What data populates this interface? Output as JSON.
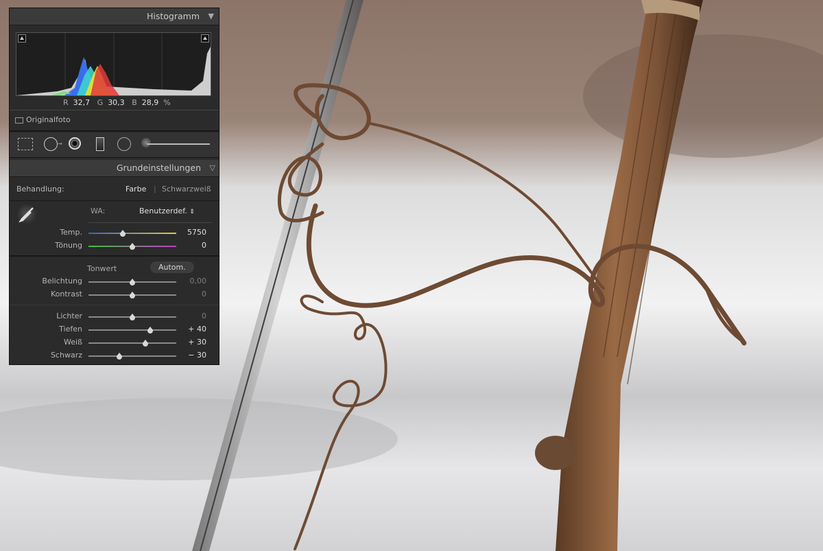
{
  "histogram": {
    "title": "Histogramm",
    "readout": {
      "r_label": "R",
      "r_value": "32,7",
      "g_label": "G",
      "g_value": "30,3",
      "b_label": "B",
      "b_value": "28,9",
      "unit": "%"
    },
    "original_photo_label": "Originalfoto"
  },
  "tools": {
    "icons": [
      "crop-overlay-icon",
      "spot-removal-icon",
      "red-eye-icon",
      "graduated-filter-icon",
      "radial-filter-icon",
      "adjustment-brush-icon"
    ],
    "amount_level": 0.03
  },
  "basic": {
    "title": "Grundeinstellungen",
    "treatment_label": "Behandlung:",
    "treatment_color": "Farbe",
    "treatment_bw": "Schwarzweiß",
    "wb_label": "WA:",
    "wb_value": "Benutzerdef.",
    "wb_arrow": "⇕",
    "tone_label": "Tonwert",
    "auto_label": "Autom.",
    "sliders": [
      {
        "label": "Temp.",
        "value": "5750",
        "level": 0.39,
        "active": true
      },
      {
        "label": "Tönung",
        "value": "0",
        "level": 0.5,
        "active": true
      },
      {
        "label": "Belichtung",
        "value": "0,00",
        "level": 0.5,
        "active": false
      },
      {
        "label": "Kontrast",
        "value": "0",
        "level": 0.5,
        "active": false
      },
      {
        "label": "Lichter",
        "value": "0",
        "level": 0.5,
        "active": false
      },
      {
        "label": "Tiefen",
        "value": "+ 40",
        "level": 0.7,
        "active": true
      },
      {
        "label": "Weiß",
        "value": "+ 30",
        "level": 0.65,
        "active": true
      },
      {
        "label": "Schwarz",
        "value": "− 30",
        "level": 0.35,
        "active": true
      }
    ]
  },
  "colors": {
    "panel_bg": "#2b2b2b",
    "header_bg": "#3b3b3b",
    "temp_track_start": "#3a5fd0",
    "temp_track_end": "#d8cf3a",
    "tint_track_start": "#3fbf3f",
    "tint_track_end": "#c040c0"
  }
}
